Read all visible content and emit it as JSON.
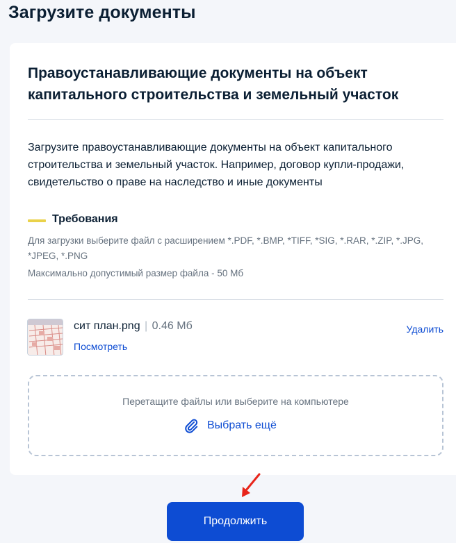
{
  "page": {
    "title": "Загрузите документы"
  },
  "section": {
    "heading": "Правоустанавливающие документы на объект капитального строительства и земельный участок",
    "description": "Загрузите правоустанавливающие документы на объект капитального строительства и земельный участок. Например, договор купли-продажи, свидетельство о праве на наследство и иные документы"
  },
  "requirements": {
    "title": "Требования",
    "formats": "Для загрузки выберите файл с расширением *.PDF, *.BMP, *TIFF, *SIG, *.RAR, *.ZIP, *.JPG, *JPEG, *.PNG",
    "max_size": "Максимально допустимый размер файла - 50 Мб"
  },
  "file": {
    "name": "сит план.png",
    "separator": "|",
    "size": "0.46 Мб",
    "view_label": "Посмотреть",
    "delete_label": "Удалить"
  },
  "dropzone": {
    "hint": "Перетащите файлы или выберите на компьютере",
    "choose_more_label": "Выбрать ещё",
    "icon": "paperclip-icon"
  },
  "actions": {
    "continue_label": "Продолжить"
  },
  "colors": {
    "accent": "#0d4cd3",
    "requirement_mark": "#ead24a",
    "annotation_arrow": "#e8251a"
  }
}
